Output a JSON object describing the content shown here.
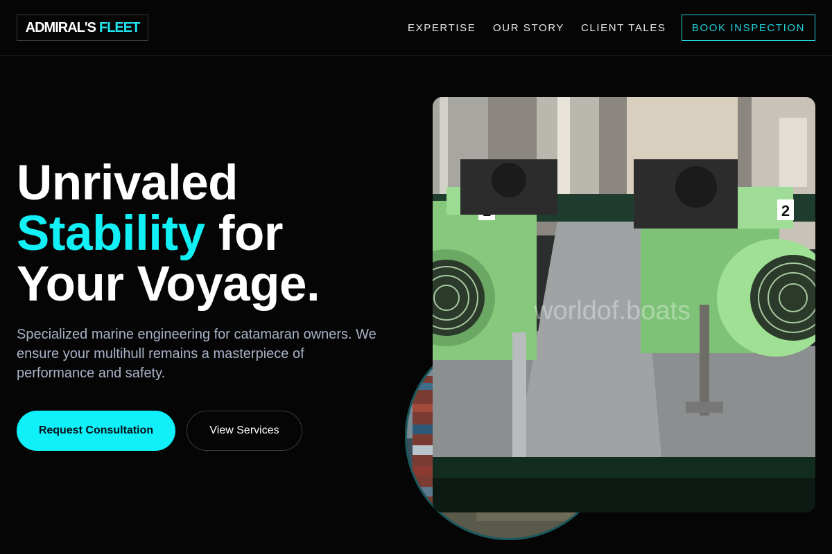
{
  "brand": {
    "name_part1": "ADMIRAL'S",
    "name_part2": "FLEET",
    "accent_color": "#22e6f2"
  },
  "nav": {
    "items": [
      {
        "label": "EXPERTISE"
      },
      {
        "label": "OUR STORY"
      },
      {
        "label": "CLIENT TALES"
      }
    ],
    "cta_label": "BOOK INSPECTION"
  },
  "hero": {
    "title_line1": "Unrivaled",
    "title_accent": "Stability",
    "title_rest": " for",
    "title_line3": "Your Voyage.",
    "subtitle": "Specialized marine engineering for catamaran owners. We ensure your multihull remains a masterpiece of performance and safety.",
    "primary_button": "Request Consultation",
    "secondary_button": "View Services"
  },
  "images": {
    "main_photo_watermark": "worldof.boats",
    "motor_labels": [
      "1",
      "2"
    ]
  }
}
